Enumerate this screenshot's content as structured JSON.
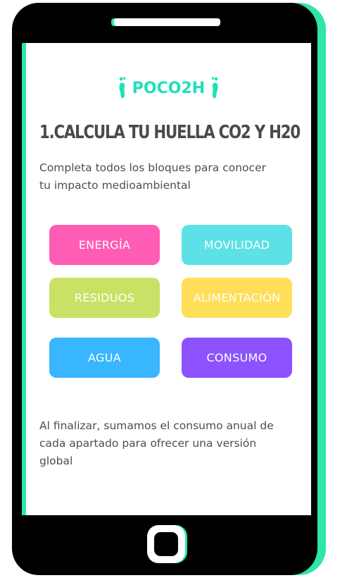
{
  "app": {
    "logo_text": "POCO2H"
  },
  "main": {
    "title": "1.CALCULA TU HUELLA CO2 Y H20",
    "intro": "Completa todos los bloques para conocer tu impacto medioambiental",
    "categories": [
      {
        "label": "ENERGÍA",
        "color": "#ff5db5"
      },
      {
        "label": "MOVILIDAD",
        "color": "#5ce1e6"
      },
      {
        "label": "RESIDUOS",
        "color": "#c9e265"
      },
      {
        "label": "ALIMENTACIÓN",
        "color": "#ffde59"
      },
      {
        "label": "AGUA",
        "color": "#38b6ff"
      },
      {
        "label": "CONSUMO",
        "color": "#8c52ff"
      }
    ],
    "outro": "Al finalizar, sumamos el consumo anual de cada apartado para ofrecer una versión global"
  },
  "colors": {
    "accent": "#2ee6a8",
    "logo": "#1fe0b8",
    "phone": "#000000"
  },
  "icons": [
    "left-foot-icon",
    "right-foot-icon"
  ]
}
